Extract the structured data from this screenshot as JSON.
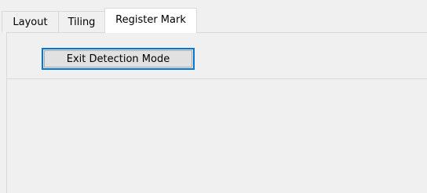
{
  "tabs": {
    "items": [
      {
        "label": "Layout",
        "selected": false
      },
      {
        "label": "Tiling",
        "selected": false
      },
      {
        "label": "Register Mark",
        "selected": true
      }
    ]
  },
  "panel": {
    "exit_button_label": "Exit Detection Mode"
  },
  "colors": {
    "window_bg": "#f0f0f0",
    "selected_tab_bg": "#ffffff",
    "tab_border": "#d9d9d9",
    "button_bg": "#e1e1e1",
    "button_focus_border": "#0078d7"
  }
}
